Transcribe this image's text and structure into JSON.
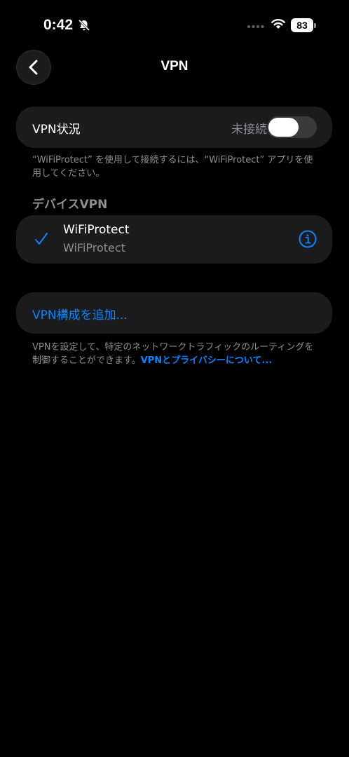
{
  "status_bar": {
    "time": "0:42",
    "battery": "83",
    "icons": [
      "bell-slash-icon",
      "signal-icon",
      "wifi-icon",
      "battery-icon"
    ]
  },
  "nav": {
    "back_icon": "chevron-left-icon",
    "title": "VPN"
  },
  "vpn_status": {
    "label": "VPN状況",
    "value": "未接続",
    "toggle_on": false
  },
  "footnote_1": "“WiFiProtect” を使用して接続するには、“WiFiProtect” アプリを使用してください。",
  "device_section": {
    "header": "デバイスVPN",
    "items": [
      {
        "name": "WiFiProtect",
        "subtitle": "WiFiProtect",
        "selected": true,
        "icon": "info-icon"
      }
    ]
  },
  "add_config": {
    "label": "VPN構成を追加..."
  },
  "footnote_2": {
    "text": "VPNを設定して、特定のネットワークトラフィックのルーティングを制御することができます。",
    "link": "VPNとプライバシーについて..."
  },
  "colors": {
    "background": "#000000",
    "card": "#1c1c1e",
    "accent": "#0a84ff",
    "secondary_text": "#8e8e93"
  }
}
